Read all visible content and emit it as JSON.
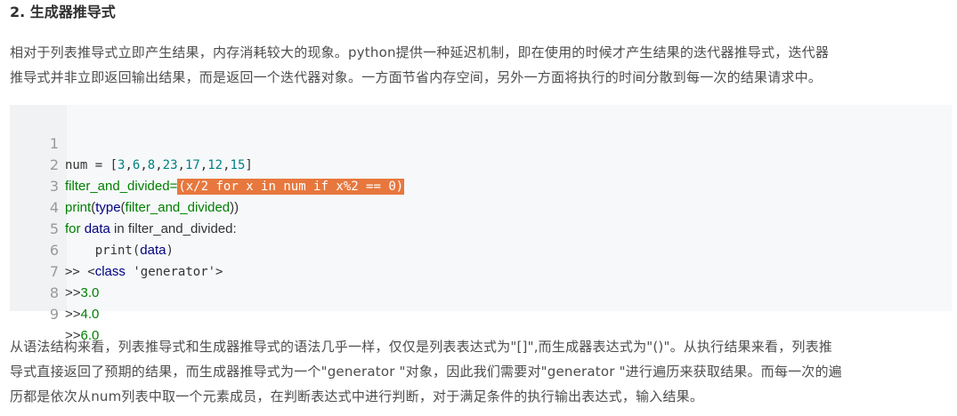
{
  "heading": "2. 生成器推导式",
  "para1_line1": "相对于列表推导式立即产生结果，内存消耗较大的现象。python提供一种延迟机制，即在使用的时候才产生结果的迭代器推导式，迭代器",
  "para1_line2": "推导式并非立即返回输出结果，而是返回一个迭代器对象。一方面节省内存空间，另外一方面将执行的时间分散到每一次的结果请求中。",
  "code": {
    "line_numbers": [
      "1",
      "2",
      "3",
      "4",
      "5",
      "6",
      "7",
      "8",
      "9"
    ],
    "l1_a": "num = [",
    "l1_b": "3",
    "l1_c": ",",
    "l1_d": "6",
    "l1_e": ",",
    "l1_f": "8",
    "l1_g": ",",
    "l1_h": "23",
    "l1_i": ",",
    "l1_j": "17",
    "l1_k": ",",
    "l1_l": "12",
    "l1_m": ",",
    "l1_n": "15",
    "l1_o": "]",
    "l2_a": "filter_and_divided=",
    "l2_b": "(x/2 for x in num if x%2 == 0)",
    "l3_a": "print",
    "l3_b": "(",
    "l3_c": "type",
    "l3_d": "(",
    "l3_e": "filter_and_divided",
    "l3_f": "))",
    "l4_a": "for",
    "l4_b": "data",
    "l4_c": " in filter_and_divided:",
    "l5_a": "    print(",
    "l5_b": "data",
    "l5_c": ")",
    "l6_a": ">> <",
    "l6_b": "class",
    "l6_c": " 'generator'>",
    "l7_a": ">>",
    "l7_b": "3.0",
    "l8_a": ">>",
    "l8_b": "4.0",
    "l9_a": ">>",
    "l9_b": "6.0"
  },
  "para2_line1": "从语法结构来看，列表推导式和生成器推导式的语法几乎一样，仅仅是列表表达式为\"[]\",而生成器表达式为\"()\"。从执行结果来看，列表推",
  "para2_line2": "导式直接返回了预期的结果，而生成器推导式为一个\"generator \"对象，因此我们需要对\"generator \"进行遍历来获取结果。而每一次的遍",
  "para2_line3": "历都是依次从num列表中取一个元素成员，在判断表达式中进行判断，对于满足条件的执行输出表达式，输入结果。",
  "colors": {
    "highlight": "#e8773d",
    "code_bg": "#f6f8fa",
    "keyword_green": "#008000",
    "keyword_navy": "#000080",
    "number_teal": "#008080"
  }
}
